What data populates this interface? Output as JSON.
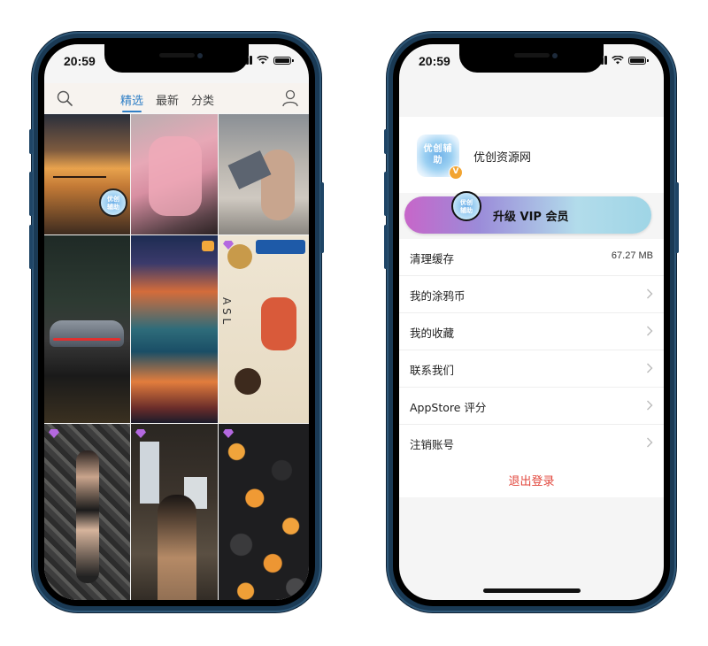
{
  "left_phone": {
    "status": {
      "time": "20:59"
    },
    "nav": {
      "search_icon": "search-icon",
      "tabs": [
        {
          "label": "精选",
          "active": true
        },
        {
          "label": "最新",
          "active": false
        },
        {
          "label": "分类",
          "active": false
        }
      ],
      "user_icon": "user-icon",
      "accent": "#2f7fc6"
    },
    "watermark_text": "优创辅助",
    "tiles": [
      {
        "name": "sunset-lake",
        "badge": "none"
      },
      {
        "name": "pink-hoodie-girl",
        "badge": "none"
      },
      {
        "name": "woman-with-jacket",
        "badge": "none"
      },
      {
        "name": "sports-car-night",
        "badge": "none"
      },
      {
        "name": "cosmic-clouds",
        "badge": "crown"
      },
      {
        "name": "one-piece-luffy",
        "badge": "gem",
        "text": "A S L"
      },
      {
        "name": "girl-tools-floor",
        "badge": "gem"
      },
      {
        "name": "woman-doorway",
        "badge": "gem"
      },
      {
        "name": "orange-stones",
        "badge": "gem"
      }
    ]
  },
  "right_phone": {
    "status": {
      "time": "20:59"
    },
    "profile": {
      "avatar_text": "优创辅助",
      "avatar_badge": "V",
      "site_name": "优创资源网"
    },
    "vip_button": {
      "label": "升级 VIP 会员",
      "avatar_text": "优创辅助"
    },
    "menu": [
      {
        "label": "清理缓存",
        "value": "67.27 MB"
      },
      {
        "label": "我的涂鸦币"
      },
      {
        "label": "我的收藏"
      },
      {
        "label": "联系我们"
      },
      {
        "label": "AppStore 评分"
      },
      {
        "label": "注销账号"
      }
    ],
    "logout": {
      "label": "退出登录",
      "color": "#e2473d"
    }
  }
}
